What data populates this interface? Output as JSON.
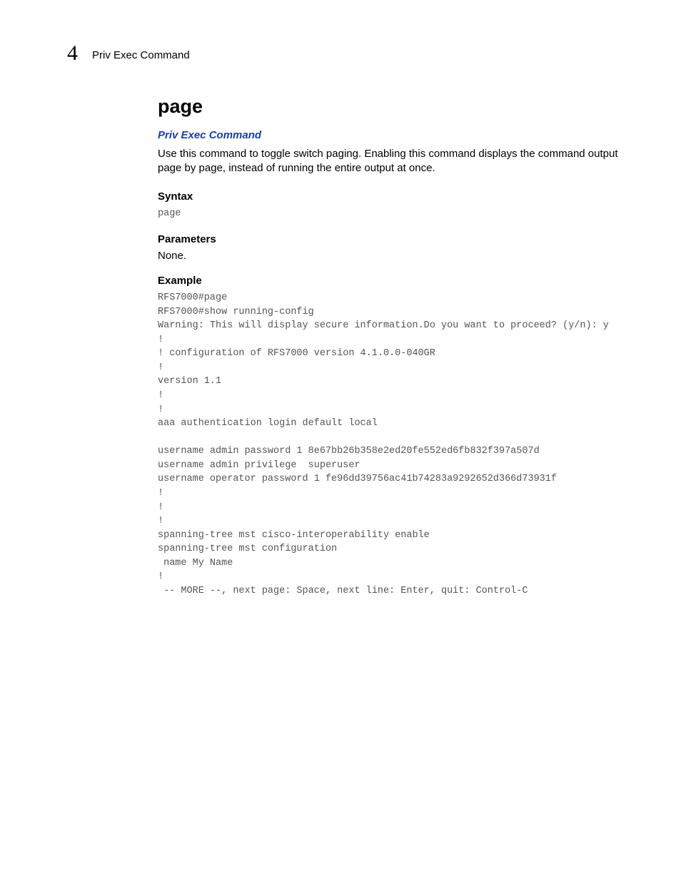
{
  "header": {
    "chapter_number": "4",
    "running_title": "Priv Exec Command"
  },
  "title": "page",
  "breadcrumb_link": "Priv Exec Command",
  "description": "Use this command to toggle switch paging. Enabling this command displays the command output page by page, instead of running the entire output at once.",
  "sections": {
    "syntax": {
      "heading": "Syntax",
      "code": "page"
    },
    "parameters": {
      "heading": "Parameters",
      "text": "None."
    },
    "example": {
      "heading": "Example",
      "code": "RFS7000#page\nRFS7000#show running-config\nWarning: This will display secure information.Do you want to proceed? (y/n): y\n!\n! configuration of RFS7000 version 4.1.0.0-040GR\n!\nversion 1.1\n!\n!\naaa authentication login default local\n\nusername admin password 1 8e67bb26b358e2ed20fe552ed6fb832f397a507d\nusername admin privilege  superuser\nusername operator password 1 fe96dd39756ac41b74283a9292652d366d73931f\n!\n!\n!\nspanning-tree mst cisco-interoperability enable\nspanning-tree mst configuration\n name My Name\n!\n -- MORE --, next page: Space, next line: Enter, quit: Control-C"
    }
  }
}
